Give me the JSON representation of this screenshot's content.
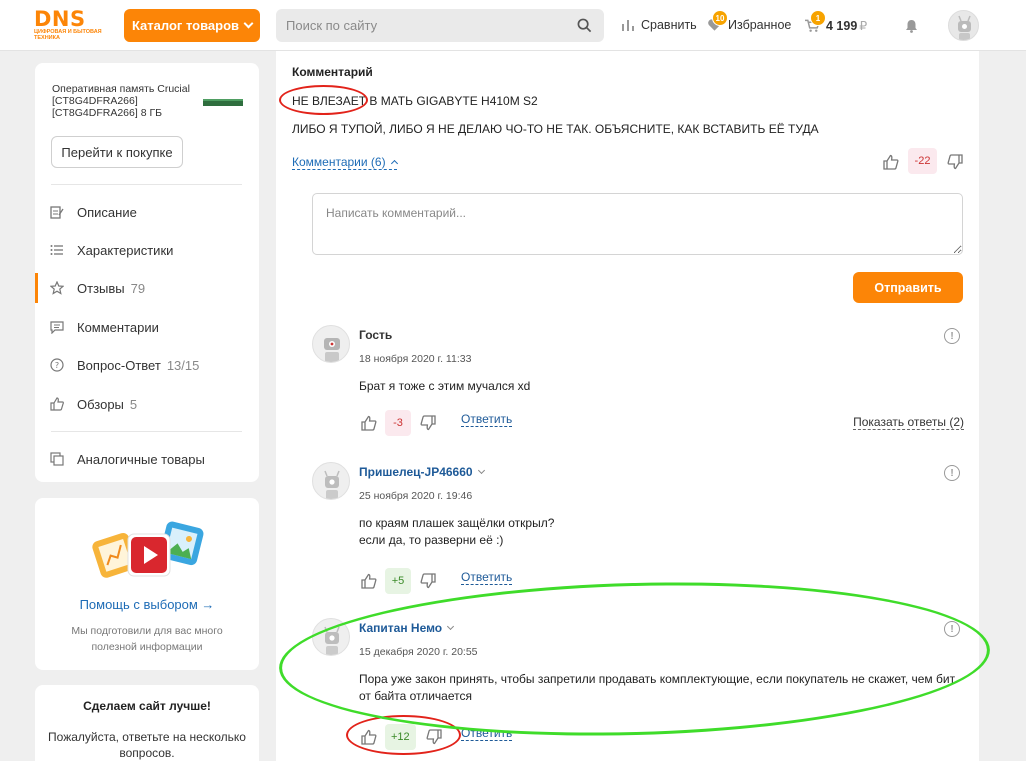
{
  "header": {
    "logo": "DNS",
    "logo_sub": "ЦИФРОВАЯ И БЫТОВАЯ ТЕХНИКА",
    "catalog_label": "Каталог товаров",
    "search_placeholder": "Поиск по сайту",
    "compare_label": "Сравнить",
    "favorites_label": "Избранное",
    "favorites_count": "10",
    "cart_count": "1",
    "cart_total": "4 199",
    "currency": "₽"
  },
  "sidebar": {
    "product_name": "Оперативная память Crucial [CT8G4DFRA266] [CT8G4DFRA266] 8 ГБ",
    "goto_purchase": "Перейти к покупке",
    "nav": [
      {
        "label": "Описание",
        "count": ""
      },
      {
        "label": "Характеристики",
        "count": ""
      },
      {
        "label": "Отзывы",
        "count": "79"
      },
      {
        "label": "Комментарии",
        "count": ""
      },
      {
        "label": "Вопрос-Ответ",
        "count": "13/15"
      },
      {
        "label": "Обзоры",
        "count": "5"
      },
      {
        "label": "Аналогичные товары",
        "count": ""
      }
    ],
    "help_title": "Помощь с выбором →",
    "help_desc": "Мы подготовили для вас много полезной информации",
    "improve_title": "Сделаем сайт лучше!",
    "improve_desc": "Пожалуйста, ответьте на несколько вопросов."
  },
  "review": {
    "comment_label": "Комментарий",
    "line1": "НЕ ВЛЕЗАЕТ В МАТЬ GIGABYTE H410M S2",
    "line2": "ЛИБО Я ТУПОЙ, ЛИБО Я НЕ ДЕЛАЮ ЧО-ТО НЕ ТАК. ОБЪЯСНИТЕ, КАК ВСТАВИТЬ ЕЁ ТУДА",
    "comments_toggle": "Комментарии (6)",
    "rating": "-22",
    "comment_placeholder": "Написать комментарий...",
    "send_label": "Отправить"
  },
  "replies": [
    {
      "name": "Гость",
      "date": "18 ноября 2020 г. 11:33",
      "text": [
        "Брат я тоже с этим мучался xd"
      ],
      "rating": "-3",
      "answer": "Ответить",
      "show_answers": "Показать ответы (2)"
    },
    {
      "name": "Пришелец-JP46660",
      "date": "25 ноября 2020 г. 19:46",
      "text": [
        "по краям плашек защёлки открыл?",
        "если да, то разверни её :)"
      ],
      "rating": "+5",
      "answer": "Ответить"
    },
    {
      "name": "Капитан Немо",
      "date": "15 декабря 2020 г. 20:55",
      "text": [
        "Пора уже закон принять, чтобы запретили продавать комплектующие, если покупатель не скажет, чем бит от байта отличается"
      ],
      "rating": "+12",
      "answer": "Ответить"
    }
  ],
  "colors": {
    "accent": "#fc8507",
    "link": "#1e6cb6",
    "annotation_red": "#e2231a",
    "annotation_green": "#3fdc2a"
  }
}
